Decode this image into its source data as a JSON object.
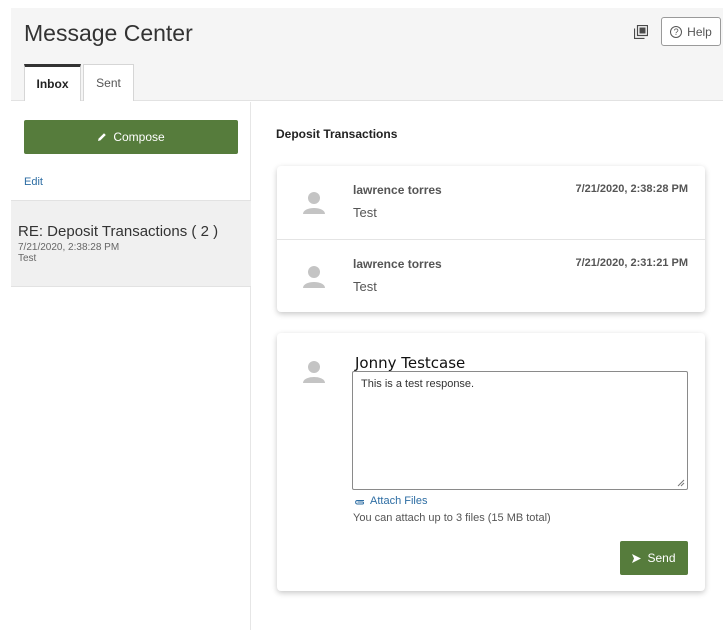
{
  "app": {
    "title": "Message Center"
  },
  "header": {
    "help_label": "Help",
    "help_icon": "question-circle-icon",
    "popout_icon": "popout-window-icon"
  },
  "tabs": [
    {
      "label": "Inbox",
      "active": true
    },
    {
      "label": "Sent",
      "active": false
    }
  ],
  "sidebar": {
    "compose_label": "Compose",
    "compose_icon": "pencil-icon",
    "edit_label": "Edit",
    "threads": [
      {
        "subject": "RE: Deposit Transactions ( 2 )",
        "date": "7/21/2020, 2:38:28 PM",
        "snippet": "Test",
        "selected": true
      }
    ]
  },
  "conversation": {
    "title": "Deposit Transactions",
    "messages": [
      {
        "author": "lawrence torres",
        "timestamp": "7/21/2020, 2:38:28 PM",
        "body": "Test"
      },
      {
        "author": "lawrence torres",
        "timestamp": "7/21/2020, 2:31:21 PM",
        "body": "Test"
      }
    ]
  },
  "reply": {
    "author": "Jonny Testcase",
    "text": "This is a test response.",
    "attach_label": "Attach Files",
    "attach_icon": "paperclip-icon",
    "attach_note": "You can attach up to 3 files (15 MB total)",
    "send_label": "Send",
    "send_icon": "send-arrow-icon"
  },
  "colors": {
    "accent_green": "#567c3c",
    "link_blue": "#2d6da3",
    "header_bg": "#f5f5f5",
    "selected_thread_bg": "#f0f0f0"
  }
}
